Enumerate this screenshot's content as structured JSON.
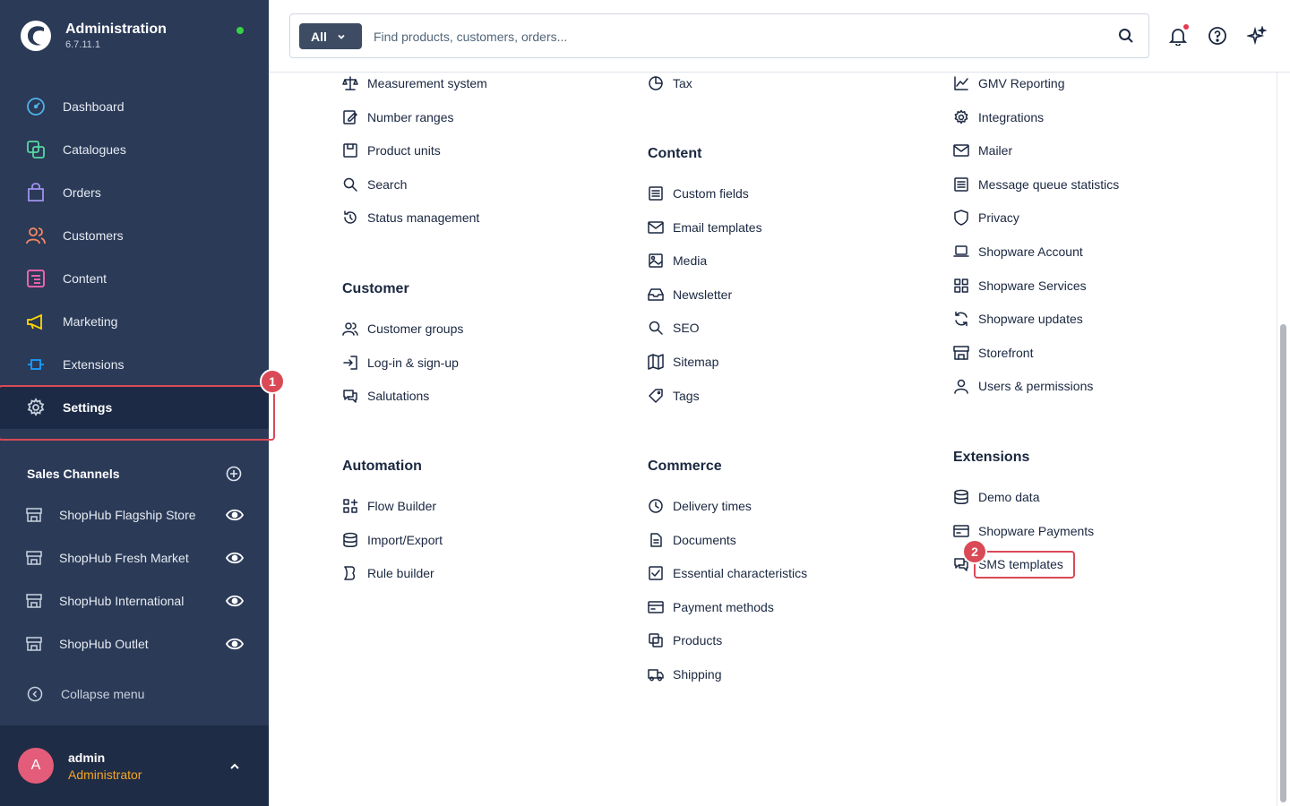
{
  "app": {
    "title": "Administration",
    "version": "6.7.11.1"
  },
  "nav": [
    {
      "label": "Dashboard",
      "icon": "dashboard-icon",
      "color": "#4fb3e8"
    },
    {
      "label": "Catalogues",
      "icon": "catalogues-icon",
      "color": "#57d9a3"
    },
    {
      "label": "Orders",
      "icon": "orders-icon",
      "color": "#a092f0"
    },
    {
      "label": "Customers",
      "icon": "customers-icon",
      "color": "#f88962"
    },
    {
      "label": "Content",
      "icon": "content-icon",
      "color": "#ff68b4"
    },
    {
      "label": "Marketing",
      "icon": "marketing-icon",
      "color": "#ffd700"
    },
    {
      "label": "Extensions",
      "icon": "extensions-icon",
      "color": "#189eff"
    },
    {
      "label": "Settings",
      "icon": "gear-icon",
      "color": "#c9d1df"
    }
  ],
  "badges": {
    "one": "1",
    "two": "2"
  },
  "sales_channels": {
    "title": "Sales Channels",
    "items": [
      "ShopHub Flagship Store",
      "ShopHub Fresh Market",
      "ShopHub International",
      "ShopHub Outlet"
    ]
  },
  "collapse_label": "Collapse menu",
  "user": {
    "initial": "A",
    "name": "admin",
    "role": "Administrator"
  },
  "search": {
    "type": "All",
    "placeholder": "Find products, customers, orders..."
  },
  "columns": {
    "c1": {
      "top": [
        "Measurement system",
        "Number ranges",
        "Product units",
        "Search",
        "Status management"
      ],
      "customer": {
        "title": "Customer",
        "items": [
          "Customer groups",
          "Log-in & sign-up",
          "Salutations"
        ]
      },
      "automation": {
        "title": "Automation",
        "items": [
          "Flow Builder",
          "Import/Export",
          "Rule builder"
        ]
      }
    },
    "c2": {
      "top": [
        "Tax"
      ],
      "content": {
        "title": "Content",
        "items": [
          "Custom fields",
          "Email templates",
          "Media",
          "Newsletter",
          "SEO",
          "Sitemap",
          "Tags"
        ]
      },
      "commerce": {
        "title": "Commerce",
        "items": [
          "Delivery times",
          "Documents",
          "Essential characteristics",
          "Payment methods",
          "Products",
          "Shipping"
        ]
      }
    },
    "c3": {
      "top": [
        "GMV Reporting",
        "Integrations",
        "Mailer",
        "Message queue statistics",
        "Privacy",
        "Shopware Account",
        "Shopware Services",
        "Shopware updates",
        "Storefront",
        "Users & permissions"
      ],
      "extensions": {
        "title": "Extensions",
        "items": [
          "Demo data",
          "Shopware Payments",
          "SMS templates"
        ]
      }
    }
  }
}
